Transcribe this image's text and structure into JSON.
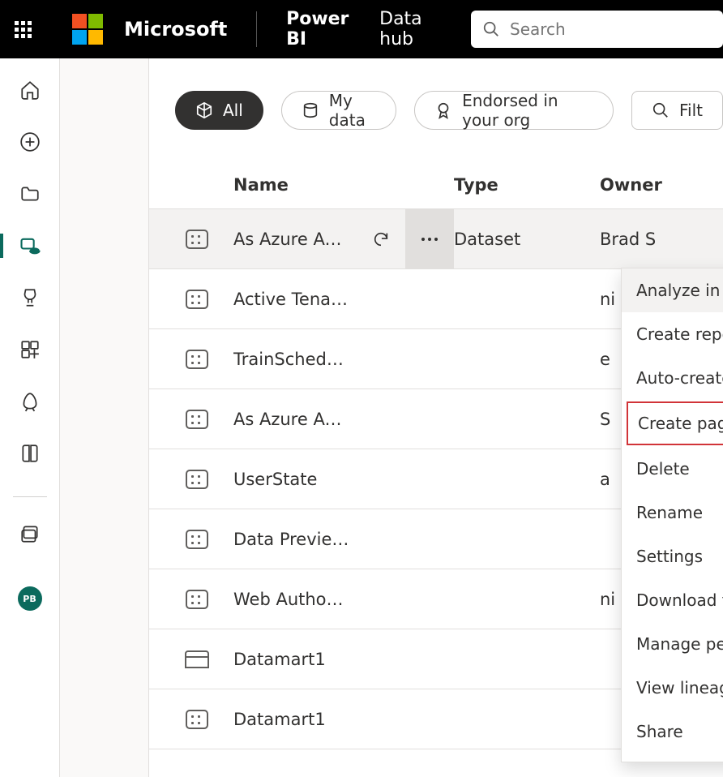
{
  "header": {
    "company": "Microsoft",
    "product": "Power BI",
    "page": "Data hub",
    "search_placeholder": "Search"
  },
  "rail": {
    "items": [
      {
        "id": "home"
      },
      {
        "id": "create"
      },
      {
        "id": "browse"
      },
      {
        "id": "data-hub",
        "active": true
      },
      {
        "id": "metrics"
      },
      {
        "id": "apps"
      },
      {
        "id": "deployment"
      },
      {
        "id": "learn"
      },
      {
        "id": "workspaces"
      }
    ],
    "avatar_initials": "PB"
  },
  "filters": {
    "all": "All",
    "mydata": "My data",
    "endorsed": "Endorsed in your org",
    "filter_label": "Filt"
  },
  "columns": {
    "name": "Name",
    "type": "Type",
    "owner": "Owner"
  },
  "rows": [
    {
      "name": "As Azure Adventure …",
      "type": "Dataset",
      "owner": "Brad S",
      "icon": "dataset",
      "hover": true
    },
    {
      "name": "Active Tenants & Renders",
      "type": "",
      "owner": "ni",
      "icon": "dataset"
    },
    {
      "name": "TrainScheduleStatus",
      "type": "",
      "owner": "e",
      "icon": "dataset"
    },
    {
      "name": "As Azure Adventure Works II",
      "type": "",
      "owner": "S",
      "icon": "dataset"
    },
    {
      "name": "UserState",
      "type": "",
      "owner": "a",
      "icon": "dataset"
    },
    {
      "name": "Data Preview Usage",
      "type": "",
      "owner": "",
      "icon": "dataset"
    },
    {
      "name": "Web Authoring Usage",
      "type": "",
      "owner": "ni",
      "icon": "dataset"
    },
    {
      "name": "Datamart1",
      "type": "",
      "owner": "",
      "icon": "datamart"
    },
    {
      "name": "Datamart1",
      "type": "",
      "owner": "",
      "icon": "dataset"
    }
  ],
  "context_menu": {
    "analyze_excel": "Analyze in Excel",
    "create_report": "Create report",
    "auto_create": "Auto-create report",
    "create_paginated": "Create paginated report",
    "delete": "Delete",
    "rename": "Rename",
    "settings": "Settings",
    "download": "Download this file",
    "manage_perm": "Manage permissions",
    "view_lineage": "View lineage",
    "share": "Share"
  }
}
